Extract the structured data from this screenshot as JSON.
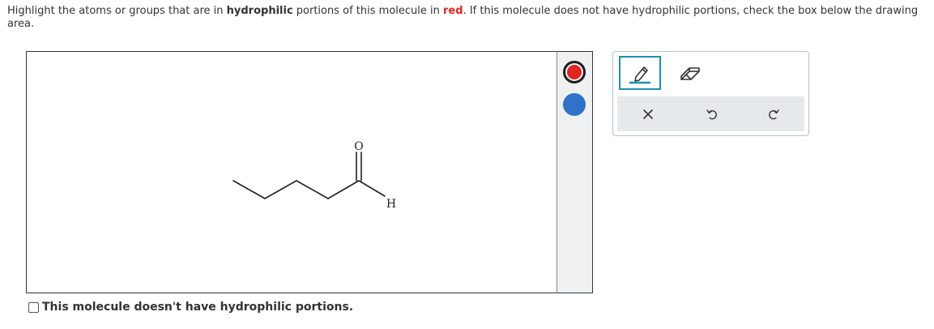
{
  "prompt": {
    "part1": "Highlight the atoms or groups that are in ",
    "bold": "hydrophilic",
    "part2": " portions of this molecule in ",
    "red_word": "red",
    "part3": ". If this molecule does not have hydrophilic portions, check the box below the drawing area."
  },
  "molecule": {
    "atoms": [
      "O",
      "H"
    ]
  },
  "palette": {
    "colors": [
      {
        "name": "red",
        "hex": "#e0261f",
        "selected": true
      },
      {
        "name": "blue",
        "hex": "#2f72c8",
        "selected": false
      }
    ]
  },
  "tools": {
    "row1": [
      "pen-icon",
      "eraser-icon"
    ],
    "row2": [
      "clear-icon",
      "undo-icon",
      "redo-icon"
    ],
    "active": "pen-icon"
  },
  "checkbox": {
    "label": "This molecule doesn't have hydrophilic portions.",
    "checked": false
  },
  "colors": {
    "accent": "#1d8fb5",
    "text": "#333333",
    "highlight_red": "#e0261f"
  }
}
